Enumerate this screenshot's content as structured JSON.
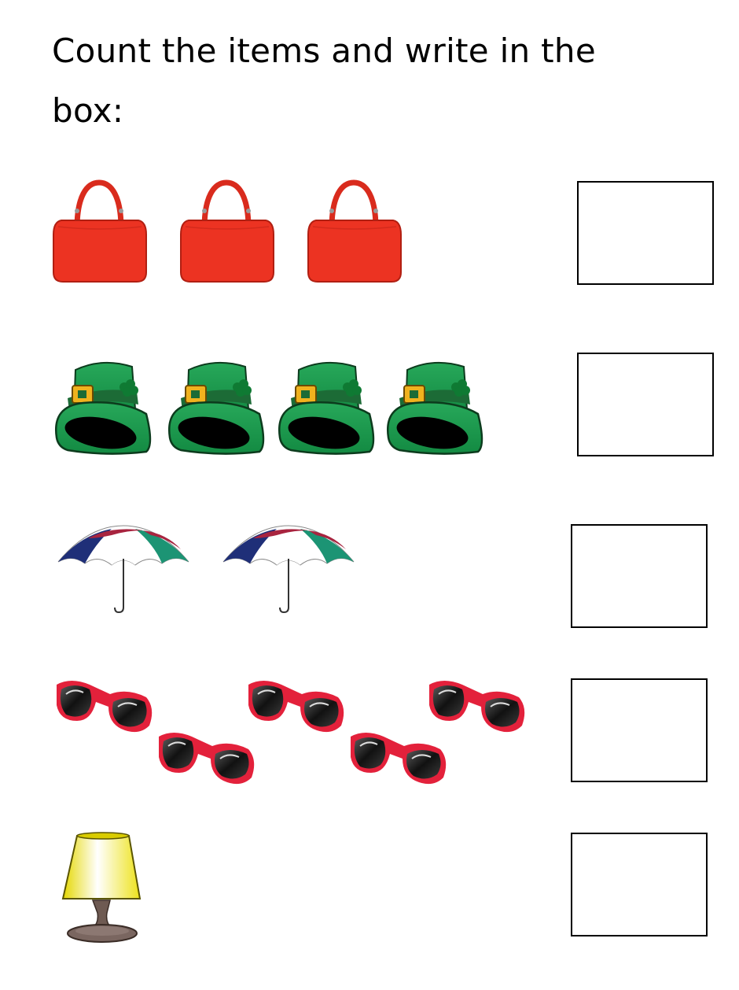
{
  "instructions": {
    "line1": "Count the items and write in the",
    "line2": "box:"
  },
  "rows": [
    {
      "item": "handbag-icon",
      "count": 3,
      "answer": ""
    },
    {
      "item": "leprechaun-hat-icon",
      "count": 4,
      "answer": ""
    },
    {
      "item": "umbrella-icon",
      "count": 2,
      "answer": ""
    },
    {
      "item": "sunglasses-icon",
      "count": 5,
      "answer": ""
    },
    {
      "item": "lamp-icon",
      "count": 1,
      "answer": ""
    }
  ],
  "colors": {
    "handbag": "#ec3322",
    "hat": "#1e9a4f",
    "umbrella_red": "#a8243f",
    "umbrella_blue": "#1f2f78",
    "umbrella_green": "#1c9474",
    "sunglasses_frame": "#e3213b",
    "lamp_shade": "#f6ee1c",
    "lamp_base": "#6e5a52"
  }
}
